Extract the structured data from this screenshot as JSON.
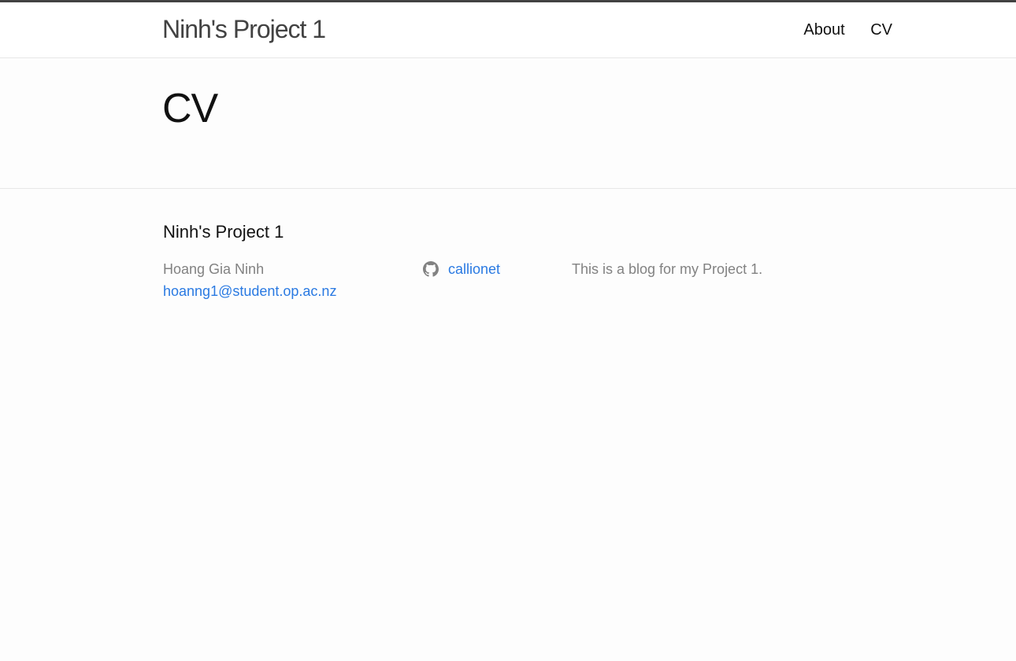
{
  "header": {
    "site_title": "Ninh's Project 1",
    "nav": [
      {
        "label": "About"
      },
      {
        "label": "CV"
      }
    ]
  },
  "main": {
    "page_title": "CV"
  },
  "footer": {
    "heading": "Ninh's Project 1",
    "author_name": "Hoang Gia Ninh",
    "email": "hoanng1@student.op.ac.nz",
    "github_username": "callionet",
    "github_icon": "github-icon",
    "description": "This is a blog for my Project 1."
  },
  "colors": {
    "link": "#2a7ae2",
    "muted_text": "#828282",
    "header_border": "#424242",
    "divider": "#e8e8e8"
  }
}
